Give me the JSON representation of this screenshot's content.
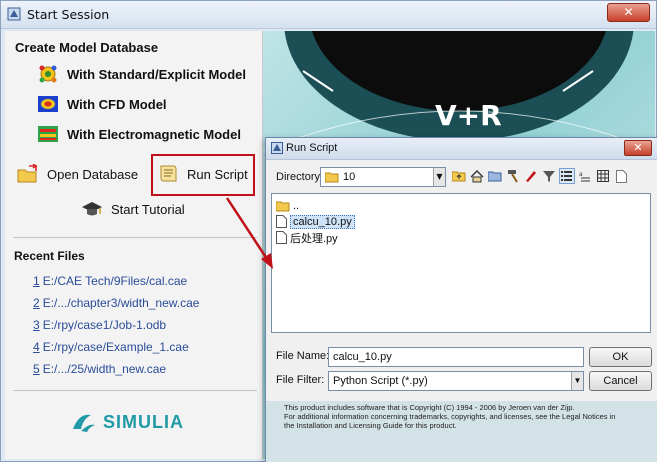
{
  "window": {
    "title": "Start Session",
    "close_label": "✕"
  },
  "create_model": {
    "heading": "Create Model Database",
    "items": [
      {
        "label": "With Standard/Explicit Model",
        "icon": "standard-model-icon"
      },
      {
        "label": "With CFD Model",
        "icon": "cfd-model-icon"
      },
      {
        "label": "With Electromagnetic Model",
        "icon": "electromagnetic-model-icon"
      }
    ]
  },
  "actions": {
    "open_database": "Open Database",
    "run_script": "Run Script",
    "start_tutorial": "Start Tutorial"
  },
  "recent_files": {
    "heading": "Recent Files",
    "items": [
      {
        "num": "1",
        "path": "E:/CAE Tech/9Files/cal.cae"
      },
      {
        "num": "2",
        "path": "E:/.../chapter3/width_new.cae"
      },
      {
        "num": "3",
        "path": "E:/rpy/case1/Job-1.odb"
      },
      {
        "num": "4",
        "path": "E:/rpy/case/Example_1.cae"
      },
      {
        "num": "5",
        "path": "E:/.../25/width_new.cae"
      }
    ]
  },
  "brand": {
    "name": "SIMULIA"
  },
  "splash": {
    "text": "V+R"
  },
  "run_script_dialog": {
    "title": "Run Script",
    "close_label": "✕",
    "directory_label": "Directory:",
    "directory_value": "10",
    "files": [
      {
        "name": "..",
        "type": "folder",
        "selected": false
      },
      {
        "name": "calcu_10.py",
        "type": "file",
        "selected": true
      },
      {
        "name": "后处理.py",
        "type": "file",
        "selected": false
      }
    ],
    "file_name_label": "File Name:",
    "file_name_value": "calcu_10.py",
    "file_filter_label": "File Filter:",
    "file_filter_value": "Python Script (*.py)",
    "ok_label": "OK",
    "cancel_label": "Cancel",
    "footer_lines": [
      "This product includes software that is Copyright (C) 1994 - 2006 by Jeroen van der Zijp.",
      "For additional information concerning trademarks, copyrights, and licenses, see the Legal Notices in",
      "the Installation and Licensing Guide for this product."
    ]
  },
  "colors": {
    "accent_red": "#c0101a",
    "link_blue": "#2a4c99",
    "brand_teal": "#1f9aa6"
  }
}
